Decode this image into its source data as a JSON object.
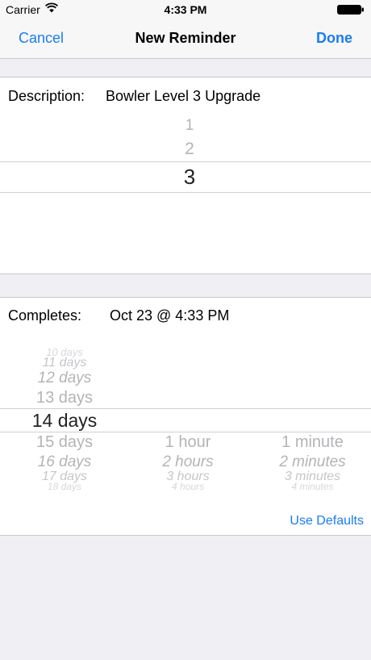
{
  "status_bar": {
    "carrier": "Carrier",
    "time": "4:33 PM",
    "icons": [
      "wifi-icon",
      "battery-icon"
    ]
  },
  "nav": {
    "cancel": "Cancel",
    "title": "New Reminder",
    "done": "Done"
  },
  "description": {
    "label": "Description:",
    "value": "Bowler Level 3 Upgrade",
    "picker": {
      "items": [
        "1",
        "2",
        "3"
      ],
      "selected": "3"
    }
  },
  "completes": {
    "label": "Completes:",
    "value": "Oct 23 @ 4:33 PM",
    "days_column": [
      "10 days",
      "11 days",
      "12 days",
      "13 days",
      "14 days",
      "15 days",
      "16 days",
      "17 days",
      "18 days"
    ],
    "days_selected": "14 days",
    "hours_column": [
      "1 hour",
      "2 hours",
      "3 hours",
      "4 hours"
    ],
    "minutes_column": [
      "1 minute",
      "2 minutes",
      "3 minutes",
      "4 minutes"
    ],
    "use_defaults": "Use Defaults"
  },
  "colors": {
    "accent": "#1a7cf5",
    "background": "#efeff4",
    "faded_text": "#b4b4b8"
  }
}
